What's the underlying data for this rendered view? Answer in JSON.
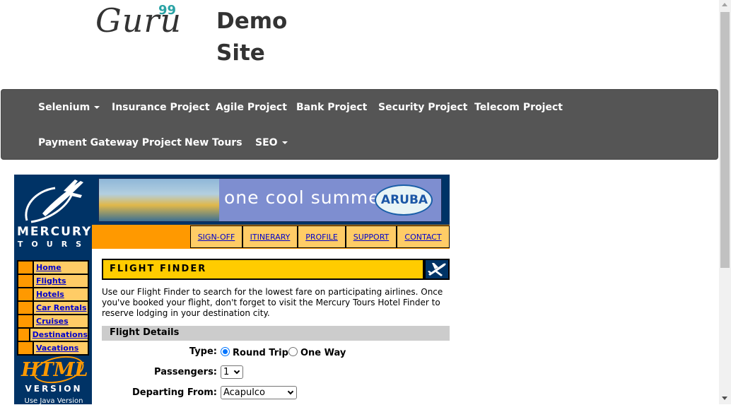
{
  "header": {
    "logo_text": "Guru",
    "logo_sup": "99",
    "site_title": "Demo Site"
  },
  "navbar": {
    "items": [
      {
        "label": "Selenium",
        "dropdown": true
      },
      {
        "label": "Insurance Project"
      },
      {
        "label": "Agile Project"
      },
      {
        "label": "Bank Project"
      },
      {
        "label": "Security Project"
      },
      {
        "label": "Telecom Project"
      },
      {
        "label": "Payment Gateway Project"
      },
      {
        "label": "New Tours"
      },
      {
        "label": "SEO",
        "dropdown": true
      }
    ]
  },
  "mercury": {
    "brand_top": "MERCURY",
    "brand_bottom": "TOURS",
    "side_menu": [
      "Home",
      "Flights",
      "Hotels",
      "Car Rentals",
      "Cruises",
      "Destinations",
      "Vacations"
    ],
    "html_badge": "HTML",
    "version_word": "VERSION",
    "java_link": "Use Java Version"
  },
  "banner": {
    "text": "one cool summer",
    "aruba": "ARUBA"
  },
  "top_links": [
    "SIGN-OFF",
    "ITINERARY",
    "PROFILE",
    "SUPPORT",
    "CONTACT"
  ],
  "flight_finder": {
    "title": "FLIGHT FINDER",
    "intro": "Use our Flight Finder to search for the lowest fare on participating airlines. Once you've booked your flight, don't forget to visit the Mercury Tours Hotel Finder to reserve lodging in your destination city.",
    "section": "Flight Details",
    "type_label": "Type:",
    "type_options": [
      "Round Trip",
      "One Way"
    ],
    "type_selected": "Round Trip",
    "passengers_label": "Passengers:",
    "passengers_value": "1",
    "departing_label": "Departing From:",
    "departing_value": "Acapulco"
  },
  "colors": {
    "navbar": "#555555",
    "mercury_blue": "#003366",
    "orange": "#ff9900",
    "light_orange": "#ffcc66",
    "yellow": "#ffcc00",
    "link": "#0000cc",
    "logo_accent": "#2aa3a5"
  },
  "icons": {
    "airplane": "airplane-icon",
    "caret": "caret-down-icon"
  }
}
